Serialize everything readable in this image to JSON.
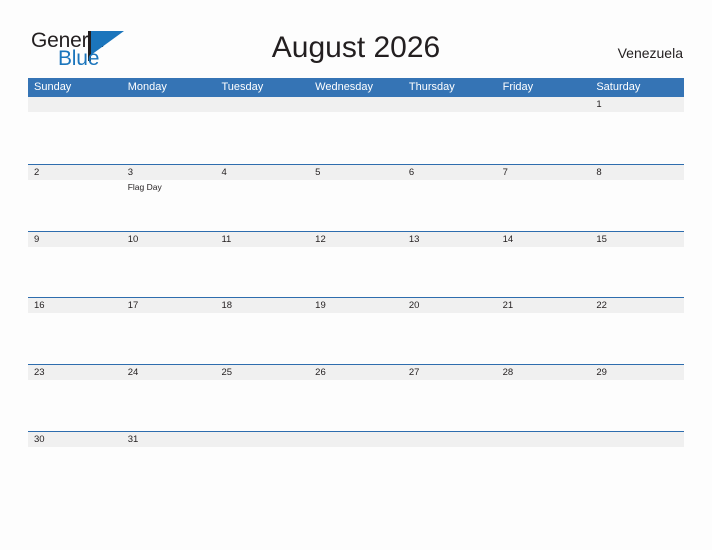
{
  "brand": {
    "name_part1": "General",
    "name_part2": "Blue",
    "accent_color": "#1B75BC",
    "dark_color": "#231F20"
  },
  "header": {
    "title": "August 2026",
    "country": "Venezuela"
  },
  "theme": {
    "header_blue": "#3574B5",
    "row_divider_blue": "#2E6DAE",
    "date_band_gray": "#F0F0F0",
    "cell_white": "#FDFDFD",
    "page_background": "#FDFDFD",
    "text_color": "#231F20"
  },
  "calendar": {
    "month": "August",
    "year": "2026",
    "weekday_headers": [
      "Sunday",
      "Monday",
      "Tuesday",
      "Wednesday",
      "Thursday",
      "Friday",
      "Saturday"
    ],
    "weeks": [
      {
        "days": [
          {
            "date": "",
            "events": []
          },
          {
            "date": "",
            "events": []
          },
          {
            "date": "",
            "events": []
          },
          {
            "date": "",
            "events": []
          },
          {
            "date": "",
            "events": []
          },
          {
            "date": "",
            "events": []
          },
          {
            "date": "1",
            "events": []
          }
        ]
      },
      {
        "days": [
          {
            "date": "2",
            "events": []
          },
          {
            "date": "3",
            "events": [
              "Flag Day"
            ]
          },
          {
            "date": "4",
            "events": []
          },
          {
            "date": "5",
            "events": []
          },
          {
            "date": "6",
            "events": []
          },
          {
            "date": "7",
            "events": []
          },
          {
            "date": "8",
            "events": []
          }
        ]
      },
      {
        "days": [
          {
            "date": "9",
            "events": []
          },
          {
            "date": "10",
            "events": []
          },
          {
            "date": "11",
            "events": []
          },
          {
            "date": "12",
            "events": []
          },
          {
            "date": "13",
            "events": []
          },
          {
            "date": "14",
            "events": []
          },
          {
            "date": "15",
            "events": []
          }
        ]
      },
      {
        "days": [
          {
            "date": "16",
            "events": []
          },
          {
            "date": "17",
            "events": []
          },
          {
            "date": "18",
            "events": []
          },
          {
            "date": "19",
            "events": []
          },
          {
            "date": "20",
            "events": []
          },
          {
            "date": "21",
            "events": []
          },
          {
            "date": "22",
            "events": []
          }
        ]
      },
      {
        "days": [
          {
            "date": "23",
            "events": []
          },
          {
            "date": "24",
            "events": []
          },
          {
            "date": "25",
            "events": []
          },
          {
            "date": "26",
            "events": []
          },
          {
            "date": "27",
            "events": []
          },
          {
            "date": "28",
            "events": []
          },
          {
            "date": "29",
            "events": []
          }
        ]
      },
      {
        "days": [
          {
            "date": "30",
            "events": []
          },
          {
            "date": "31",
            "events": []
          },
          {
            "date": "",
            "events": []
          },
          {
            "date": "",
            "events": []
          },
          {
            "date": "",
            "events": []
          },
          {
            "date": "",
            "events": []
          },
          {
            "date": "",
            "events": []
          }
        ]
      }
    ]
  }
}
